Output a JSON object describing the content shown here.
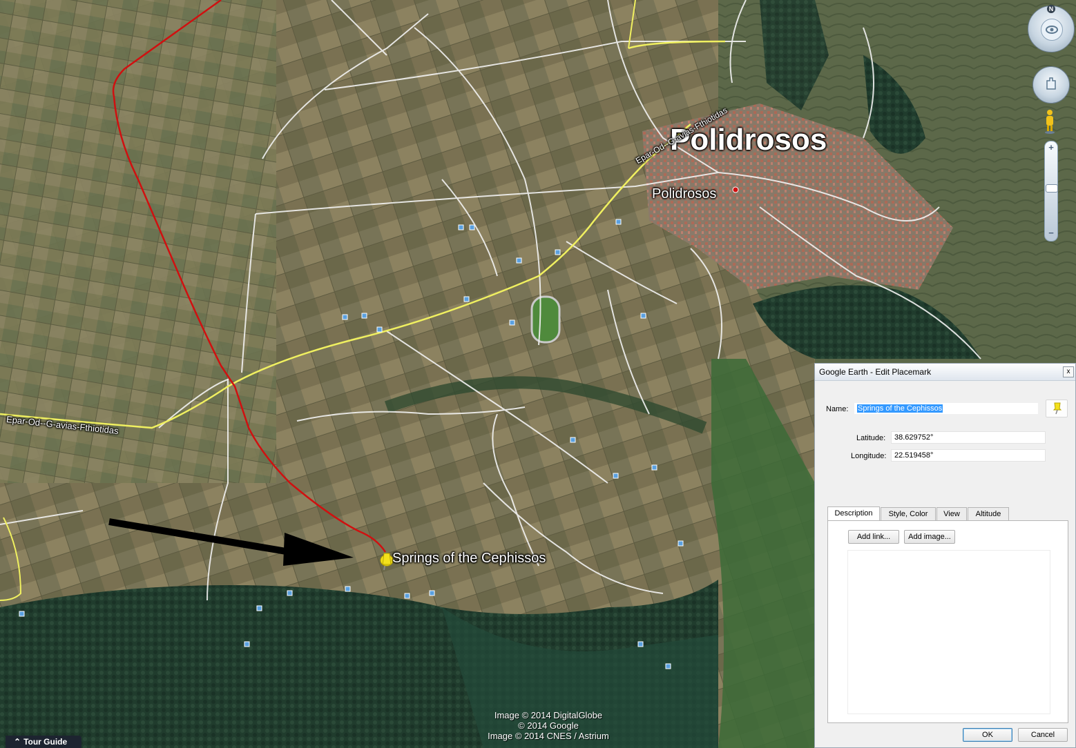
{
  "map": {
    "town_label_large": "Polidrosos",
    "town_label_small": "Polidrosos",
    "road_label_a": "Epar-Od--G-avias-Fthiotidas",
    "road_label_b": "Epar-Od--G-avias-Fthiotidas",
    "placemark_label": "Springs of the Cephissos",
    "copyright": [
      "Image © 2014 DigitalGlobe",
      "© 2014 Google",
      "Image © 2014 CNES / Astrium"
    ],
    "colors": {
      "river_line": "#d01010",
      "road_main": "#f0f060",
      "road_minor": "#f2f2f2",
      "terrain": "#6e6b4b",
      "forest": "#1f3b2b",
      "town": "#9b7b72"
    }
  },
  "tour_guide": {
    "label": "Tour Guide",
    "icon": "chevron-up-icon"
  },
  "navigation": {
    "compass_letter": "N",
    "zoom_in": "+",
    "zoom_out": "−",
    "icons": [
      "compass-icon",
      "look-eye-icon",
      "move-hand-icon",
      "pegman-icon",
      "zoom-slider-icon"
    ]
  },
  "dialog": {
    "title": "Google Earth - Edit Placemark",
    "close": "x",
    "name_label": "Name:",
    "name_value": "Springs of the Cephissos",
    "latitude_label": "Latitude:",
    "latitude_value": "38.629752°",
    "longitude_label": "Longitude:",
    "longitude_value": "22.519458°",
    "tabs": [
      {
        "label": "Description",
        "active": true
      },
      {
        "label": "Style, Color",
        "active": false
      },
      {
        "label": "View",
        "active": false
      },
      {
        "label": "Altitude",
        "active": false
      }
    ],
    "add_link": "Add link...",
    "add_image": "Add image...",
    "description": "",
    "ok": "OK",
    "cancel": "Cancel",
    "pin_icon": "yellow-pushpin-icon"
  }
}
